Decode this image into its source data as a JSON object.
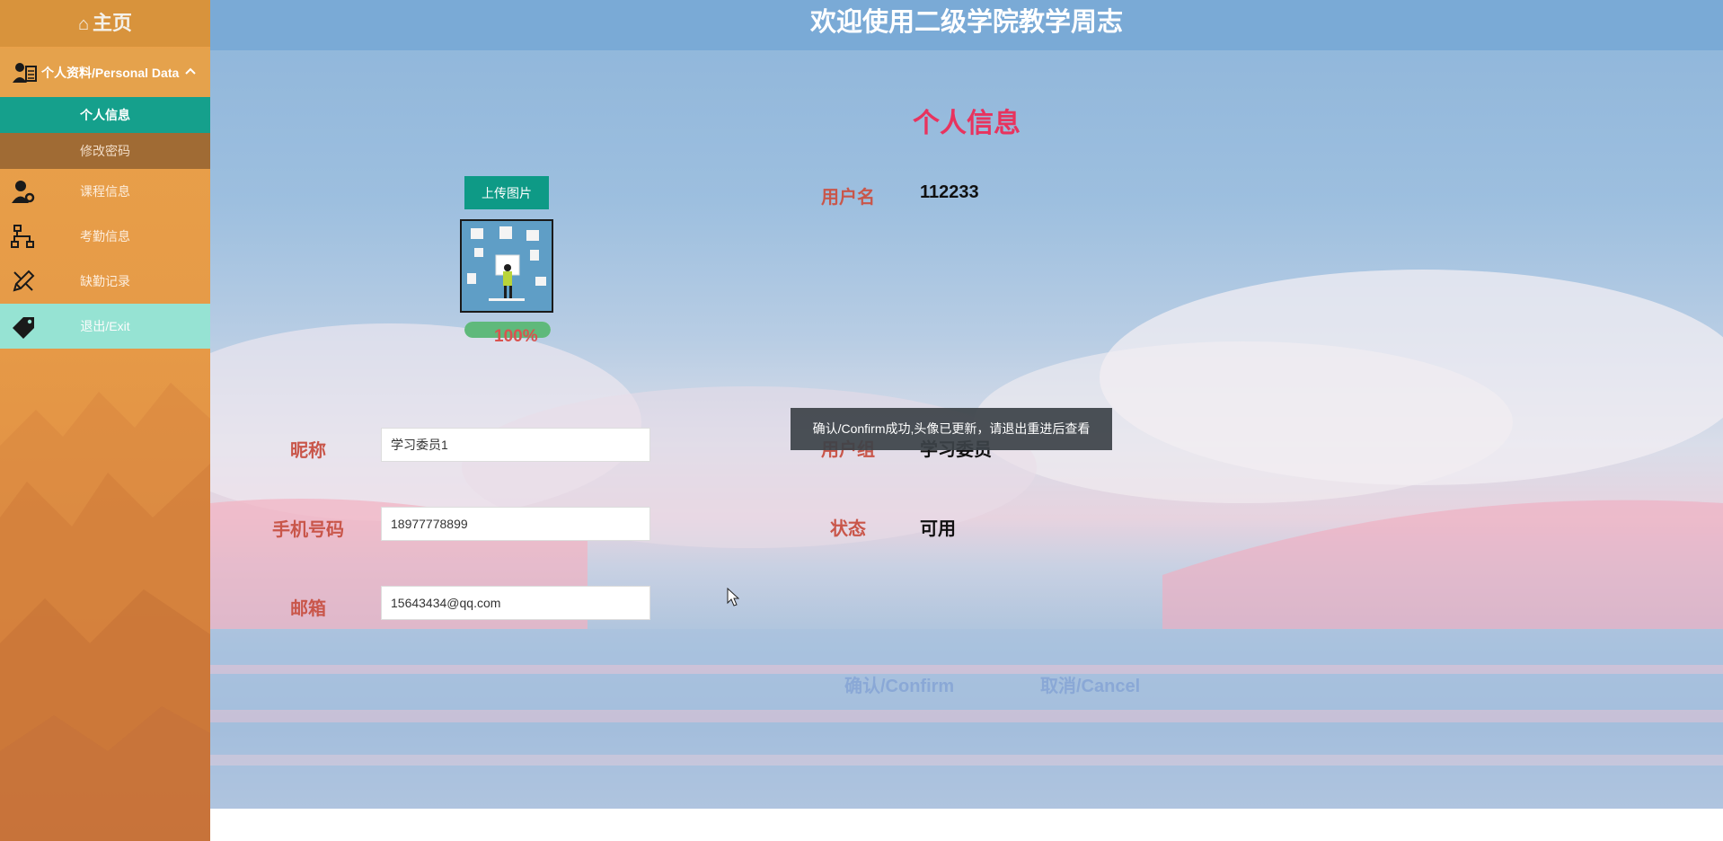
{
  "sidebar": {
    "home_label": "主页",
    "group": {
      "label": "个人资料/Personal Data"
    },
    "sub_items": [
      {
        "label": "个人信息",
        "active": true
      },
      {
        "label": "修改密码",
        "active": false
      }
    ],
    "items": [
      {
        "label": "课程信息",
        "icon": "user-gear-icon"
      },
      {
        "label": "考勤信息",
        "icon": "org-chart-icon"
      },
      {
        "label": "缺勤记录",
        "icon": "pencil-ruler-icon"
      },
      {
        "label": "退出/Exit",
        "icon": "tag-icon"
      }
    ]
  },
  "header": {
    "title": "欢迎使用二级学院教学周志"
  },
  "main": {
    "title": "个人信息",
    "upload_label": "上传图片",
    "upload_progress": 100,
    "upload_progress_text": "100%",
    "fields": {
      "username": {
        "label": "用户名",
        "value": "112233"
      },
      "nickname": {
        "label": "昵称",
        "value": "学习委员1"
      },
      "user_group": {
        "label": "用户组",
        "value": "学习委员"
      },
      "phone": {
        "label": "手机号码",
        "value": "18977778899"
      },
      "status": {
        "label": "状态",
        "value": "可用"
      },
      "email": {
        "label": "邮箱",
        "value": "15643434@qq.com"
      }
    },
    "toast": "确认/Confirm成功,头像已更新，请退出重进后查看",
    "confirm_label": "确认/Confirm",
    "cancel_label": "取消/Cancel"
  },
  "colors": {
    "sidebar": "#e69a47",
    "active_item": "#15a08c",
    "topbar": "#7aaad6",
    "title": "#e8335e",
    "label": "#c9564a",
    "button": "#0e9a86"
  }
}
